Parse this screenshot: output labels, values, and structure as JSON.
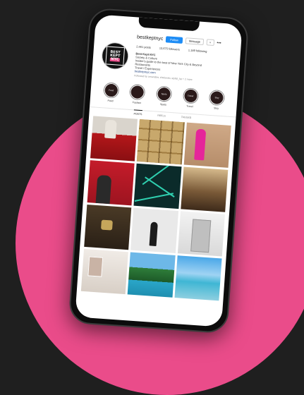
{
  "profile": {
    "username": "bestkeptnyc",
    "follow_label": "Follow",
    "message_label": "Message",
    "more_label": "˅",
    "options_label": "•••",
    "stats": {
      "posts": "2,461 posts",
      "followers": "13,675 followers",
      "following": "1,189 following"
    },
    "avatar_text": [
      "BEST",
      "KEPT",
      "NYC"
    ],
    "bio": {
      "name": "Best Kept NYC",
      "line1": "Society & Culture",
      "line2": "Insider's guide to the best of New York City & Beyond",
      "line3": "Restaurants",
      "line4": "Travel / Experiences",
      "link": "bestkeptnyc.com"
    },
    "followed_by": "Followed by amandaw, chelsealu, stylist_kp + 2 more"
  },
  "highlights": [
    {
      "cover": "Food",
      "label": "Food"
    },
    {
      "cover": "",
      "label": "Fashion"
    },
    {
      "cover": "Spots",
      "label": "Spots"
    },
    {
      "cover": "Travel",
      "label": "Travel"
    },
    {
      "cover": "Stay",
      "label": "Stay"
    }
  ],
  "tabs": [
    "POSTS",
    "REELS",
    "TAGGED"
  ],
  "colors": {
    "accent": "#ea4c8a",
    "follow": "#1d8cf5",
    "background": "#1f1f1f"
  }
}
